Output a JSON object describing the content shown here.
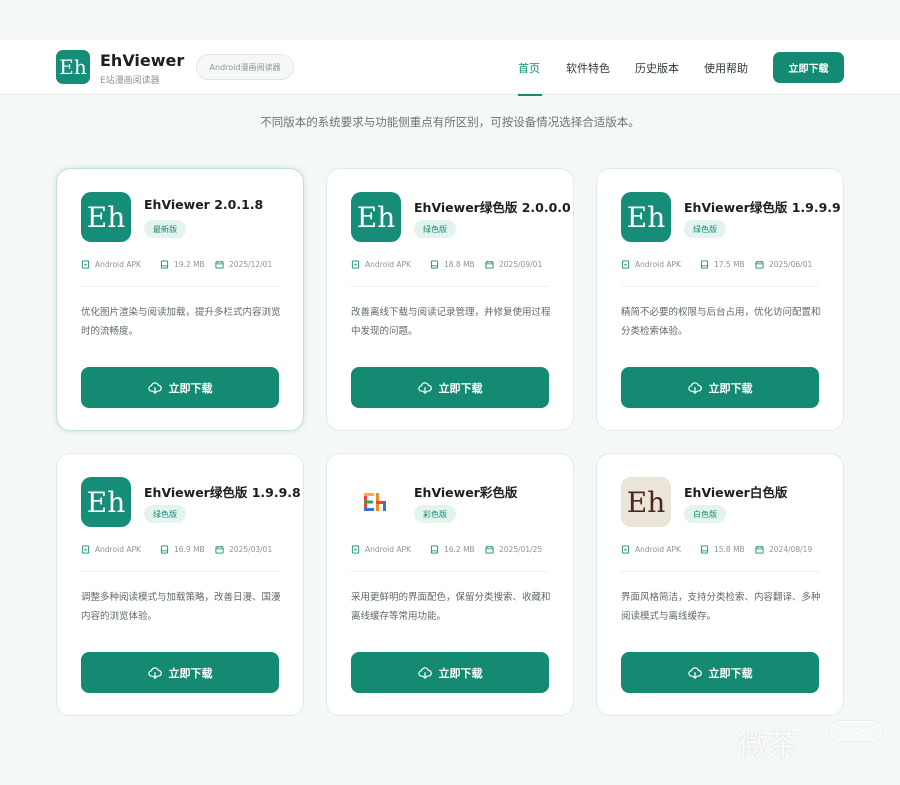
{
  "header": {
    "logo_text": "Eh",
    "brand_name": "EhViewer",
    "brand_sub": "E站漫画阅读器",
    "pill": "Android漫画阅读器",
    "nav": [
      "首页",
      "软件特色",
      "历史版本",
      "使用帮助"
    ],
    "download_label": "立即下载"
  },
  "subtitle": "不同版本的系统要求与功能侧重点有所区别，可按设备情况选择合适版本。",
  "icons": {
    "meta_platform": "android-file-icon",
    "meta_size": "storage-icon",
    "meta_date": "calendar-icon",
    "download": "cloud-download-icon"
  },
  "colors": {
    "accent": "#148a73",
    "badge_bg": "#e3f3ee",
    "white_icon_bg": "#ebe4d8"
  },
  "cards": [
    {
      "icon_text": "Eh",
      "title": "EhViewer 2.0.1.8",
      "badge": "最新版",
      "platform": "Android APK",
      "size": "19.2 MB",
      "date": "2025/12/01",
      "desc": "优化图片渲染与阅读加载，提升多栏式内容浏览时的流畅度。",
      "button": "立即下载"
    },
    {
      "icon_text": "Eh",
      "title": "EhViewer绿色版 2.0.0.0",
      "badge": "绿色版",
      "platform": "Android APK",
      "size": "18.8 MB",
      "date": "2025/09/01",
      "desc": "改善离线下载与阅读记录管理，并修复使用过程中发现的问题。",
      "button": "立即下载"
    },
    {
      "icon_text": "Eh",
      "title": "EhViewer绿色版 1.9.9.9",
      "badge": "绿色版",
      "platform": "Android APK",
      "size": "17.5 MB",
      "date": "2025/06/01",
      "desc": "精简不必要的权限与后台占用，优化访问配置和分类检索体验。",
      "button": "立即下载"
    },
    {
      "icon_text": "Eh",
      "title": "EhViewer绿色版 1.9.9.8",
      "badge": "绿色版",
      "platform": "Android APK",
      "size": "16.9 MB",
      "date": "2025/03/01",
      "desc": "调整多种阅读模式与加载策略，改善日漫、国漫内容的浏览体验。",
      "button": "立即下载"
    },
    {
      "icon_text": "Eh",
      "title": "EhViewer彩色版",
      "badge": "彩色版",
      "platform": "Android APK",
      "size": "16.2 MB",
      "date": "2025/01/25",
      "desc": "采用更鲜明的界面配色，保留分类搜索、收藏和离线缓存等常用功能。",
      "button": "立即下载"
    },
    {
      "icon_text": "Eh",
      "title": "EhViewer白色版",
      "badge": "白色版",
      "platform": "Android APK",
      "size": "15.8 MB",
      "date": "2024/08/19",
      "desc": "界面风格简洁，支持分类检索、内容翻译、多种阅读模式与离线缓存。",
      "button": "立即下载"
    }
  ],
  "watermark": {
    "text": "微茶",
    "badge": "WXCHA"
  }
}
